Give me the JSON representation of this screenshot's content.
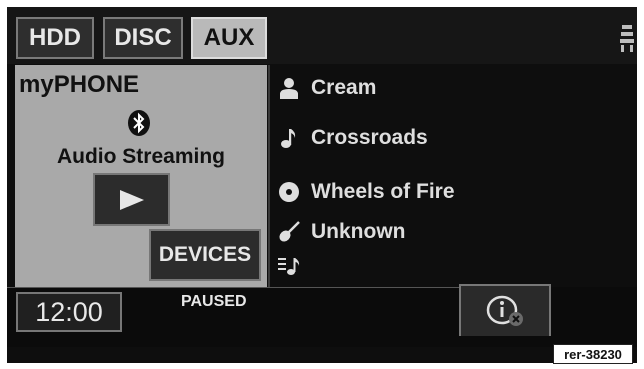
{
  "tabs": [
    {
      "label": "HDD",
      "active": false
    },
    {
      "label": "DISC",
      "active": false
    },
    {
      "label": "AUX",
      "active": true
    }
  ],
  "source": {
    "title": "myPHONE",
    "status_label": "Audio Streaming",
    "devices_label": "DEVICES"
  },
  "track_info": [
    {
      "icon": "artist-icon",
      "text": "Cream"
    },
    {
      "icon": "song-note-icon",
      "text": "Crossroads"
    },
    {
      "icon": "album-disc-icon",
      "text": "Wheels of Fire"
    },
    {
      "icon": "genre-guitar-icon",
      "text": "Unknown"
    },
    {
      "icon": "playlist-icon",
      "text": ""
    }
  ],
  "footer": {
    "time": "12:00",
    "playback_state": "PAUSED"
  },
  "figure_id": "rer-38230",
  "colors": {
    "screen_bg": "#0e0e0e",
    "panel_bg": "#a9a9a9",
    "active_tab": "#b9b9b9",
    "text_light": "#dedede"
  }
}
